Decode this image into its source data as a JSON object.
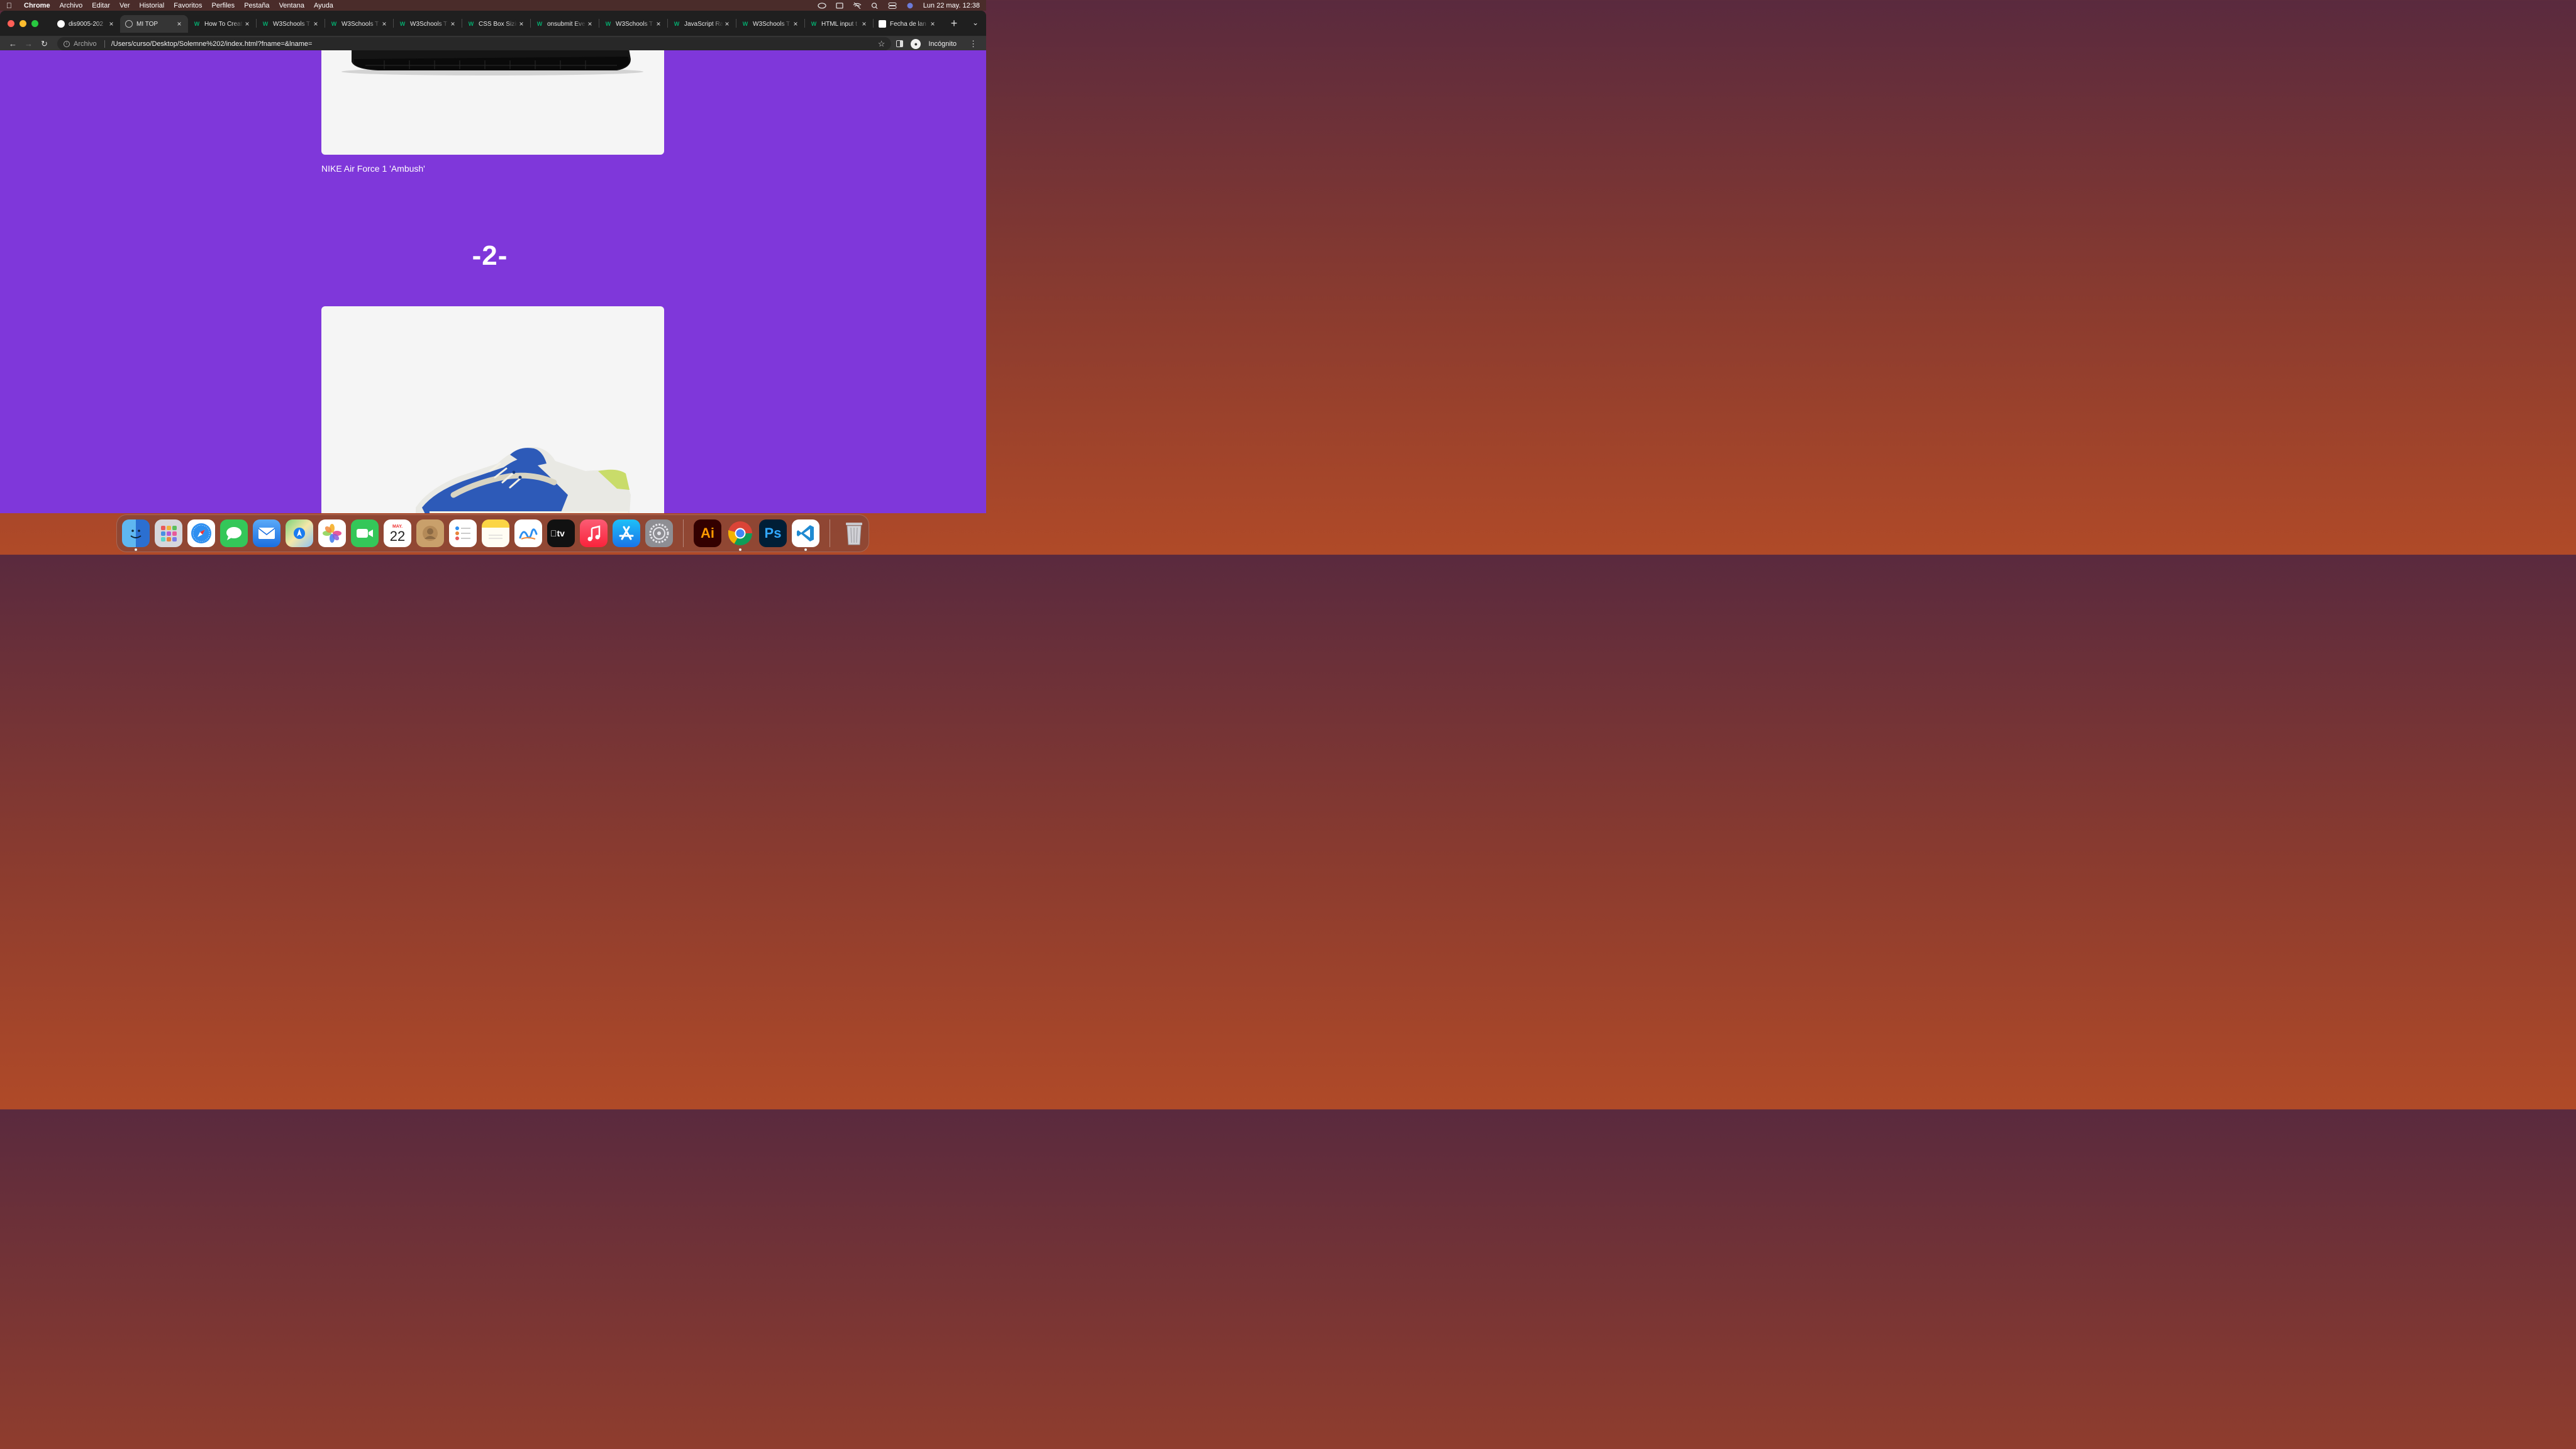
{
  "menubar": {
    "app": "Chrome",
    "items": [
      "Archivo",
      "Editar",
      "Ver",
      "Historial",
      "Favoritos",
      "Perfiles",
      "Pestaña",
      "Ventana",
      "Ayuda"
    ],
    "datetime": "Lun 22 may.  12:38"
  },
  "tabs": [
    {
      "title": "dis9005-202",
      "icon": "github-icon"
    },
    {
      "title": "MI TOP",
      "icon": "globe-icon",
      "active": true
    },
    {
      "title": "How To Creat",
      "icon": "w3schools-icon"
    },
    {
      "title": "W3Schools T",
      "icon": "w3schools-icon"
    },
    {
      "title": "W3Schools T",
      "icon": "w3schools-icon"
    },
    {
      "title": "W3Schools T",
      "icon": "w3schools-icon"
    },
    {
      "title": "CSS Box Sizin",
      "icon": "w3schools-icon"
    },
    {
      "title": "onsubmit Eve",
      "icon": "w3schools-icon"
    },
    {
      "title": "W3Schools T",
      "icon": "w3schools-icon"
    },
    {
      "title": "JavaScript Ra",
      "icon": "w3schools-icon"
    },
    {
      "title": "W3Schools T",
      "icon": "w3schools-icon"
    },
    {
      "title": "HTML input t",
      "icon": "w3schools-icon"
    },
    {
      "title": "Fecha de lan",
      "icon": "nike-icon"
    }
  ],
  "toolbar": {
    "scheme_label": "Archivo",
    "url": "/Users/curso/Desktop/Solemne%202/index.html?fname=&lname=",
    "profile_label": "Incógnito"
  },
  "page": {
    "background_color": "#7f37da",
    "product1_caption": "NIKE Air Force 1 'Ambush'",
    "rank_label": "-2-"
  },
  "dock": {
    "apps": [
      "finder-icon",
      "launchpad-icon",
      "safari-icon",
      "messages-icon",
      "mail-icon",
      "maps-icon",
      "photos-icon",
      "facetime-icon",
      "calendar-icon",
      "contacts-icon",
      "reminders-icon",
      "notes-icon",
      "freeform-icon",
      "apple-tv-icon",
      "music-icon",
      "app-store-icon",
      "system-settings-icon",
      "illustrator-icon",
      "chrome-icon",
      "photoshop-icon",
      "vscode-icon",
      "trash-icon"
    ],
    "calendar_month": "MAY.",
    "calendar_day": "22",
    "illustrator_label": "Ai",
    "photoshop_label": "Ps"
  }
}
